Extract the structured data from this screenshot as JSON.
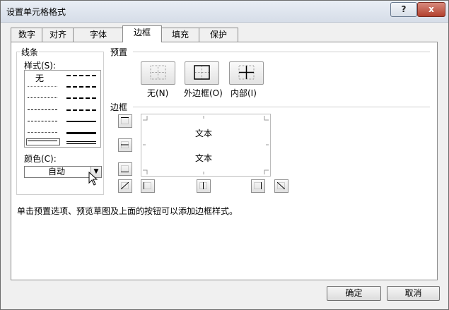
{
  "dialog": {
    "title": "设置单元格格式",
    "help_label": "?",
    "close_label": "x"
  },
  "tabs": [
    {
      "label": "数字",
      "active": false
    },
    {
      "label": "对齐",
      "active": false
    },
    {
      "label": "字体",
      "active": false
    },
    {
      "label": "边框",
      "active": true
    },
    {
      "label": "填充",
      "active": false
    },
    {
      "label": "保护",
      "active": false
    }
  ],
  "line_section": {
    "group_label": "线条",
    "style_label": "样式(S):",
    "none_label": "无",
    "color_label": "颜色(C):",
    "color_value": "自动"
  },
  "presets": {
    "label": "预置",
    "items": [
      {
        "label": "无(N)",
        "icon": "no-border-icon"
      },
      {
        "label": "外边框(O)",
        "icon": "outline-border-icon"
      },
      {
        "label": "内部(I)",
        "icon": "inside-border-icon"
      }
    ]
  },
  "border_section": {
    "label": "边框",
    "preview_text_top": "文本",
    "preview_text_bottom": "文本"
  },
  "hint": "单击预置选项、预览草图及上面的按钮可以添加边框样式。",
  "buttons": {
    "ok": "确定",
    "cancel": "取消"
  }
}
